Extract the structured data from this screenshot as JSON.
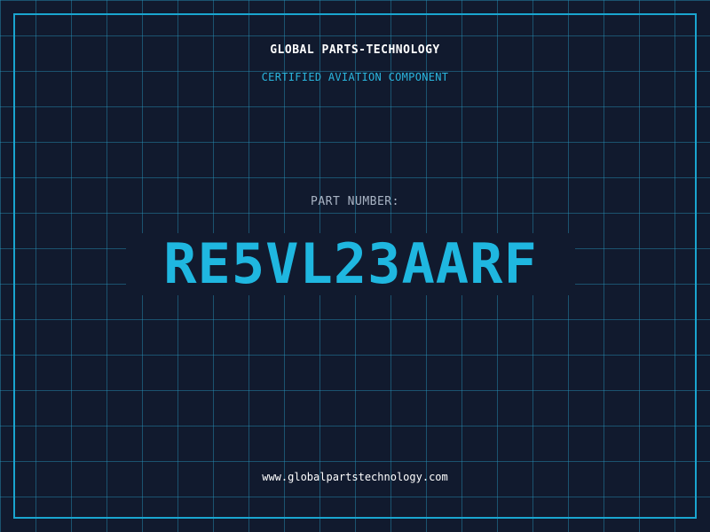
{
  "header": {
    "company_name": "GLOBAL PARTS-TECHNOLOGY",
    "tagline": "CERTIFIED AVIATION COMPONENT"
  },
  "part": {
    "label": "PART NUMBER:",
    "number": "RE5VL23AARF"
  },
  "footer": {
    "website": "www.globalpartstechnology.com"
  },
  "colors": {
    "background": "#111a2e",
    "grid": "#2896be",
    "frame": "#1aa5cf",
    "accent": "#1fb7e0",
    "label": "#a9b4c4",
    "text": "#ffffff"
  }
}
